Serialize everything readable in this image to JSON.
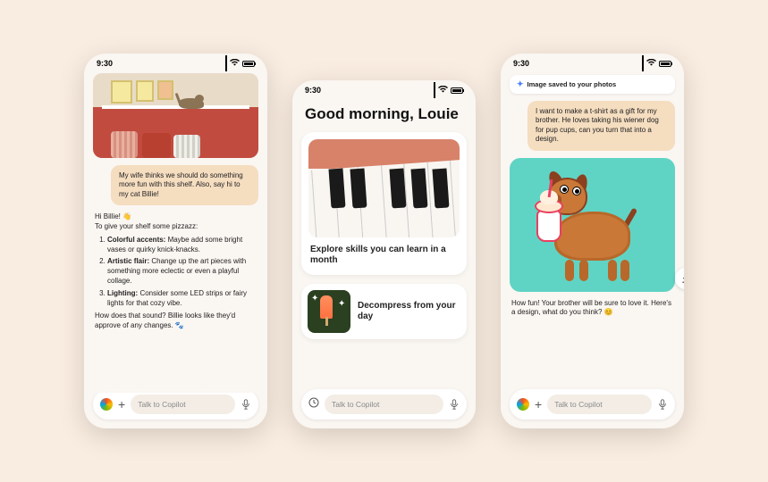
{
  "status": {
    "time": "9:30"
  },
  "input": {
    "placeholder": "Talk to Copilot"
  },
  "phone1": {
    "user_msg": "My wife thinks we should do something more fun with this shelf. Also, say hi to my cat Billie!",
    "greeting": "Hi Billie! 👋",
    "intro": "To give your shelf some pizzazz:",
    "items": [
      {
        "bold": "Colorful accents:",
        "rest": " Maybe add some bright vases or quirky knick-knacks."
      },
      {
        "bold": "Artistic flair:",
        "rest": " Change up the art pieces with something more eclectic or even a playful collage."
      },
      {
        "bold": "Lighting:",
        "rest": " Consider some LED strips or fairy lights for that cozy vibe."
      }
    ],
    "outro": "How does that sound? Billie looks like they'd approve of any changes. 🐾"
  },
  "phone2": {
    "greeting": "Good morning, Louie",
    "card1": "Explore skills you can learn in a month",
    "card2": "Decompress from your day"
  },
  "phone3": {
    "toast": "Image saved to your photos",
    "user_msg": "I want to make a t-shirt as a gift for my brother. He loves taking his wiener dog for pup cups, can you turn that into a design.",
    "bot_reply": "How fun! Your brother will be sure to love it. Here's a design, what do you think? 😊"
  }
}
